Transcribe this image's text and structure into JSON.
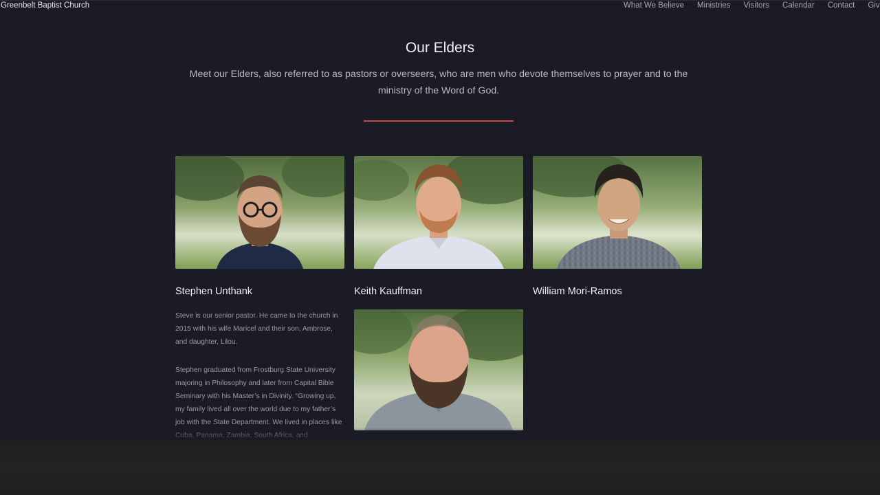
{
  "header": {
    "brand": "Greenbelt Baptist Church",
    "nav": [
      {
        "label": "What We Believe"
      },
      {
        "label": "Ministries"
      },
      {
        "label": "Visitors"
      },
      {
        "label": "Calendar"
      },
      {
        "label": "Contact"
      },
      {
        "label": "Give"
      }
    ]
  },
  "hero": {
    "title": "Our Elders",
    "subtitle": "Meet our Elders, also referred to as pastors or overseers, who are men who devote themselves to prayer and to the ministry of the Word of God.",
    "accent_color": "#d3424f"
  },
  "elders": [
    {
      "name": "Stephen Unthank",
      "photo_icon": "bearded-man-glasses-photo"
    },
    {
      "name": "Keith Kauffman",
      "photo_icon": "red-haired-man-photo"
    },
    {
      "name": "William Mori-Ramos",
      "photo_icon": "dark-haired-man-photo"
    },
    {
      "name": "",
      "photo_icon": "bearded-man-gray-shirt-photo"
    }
  ],
  "bio": {
    "paragraph_1": "Steve is our senior pastor. He came to the church in 2015 with his wife Maricel and their son, Ambrose, and daughter, Lilou.",
    "paragraph_2": "Stephen graduated from Frostburg State University majoring in Philosophy and later from Capital Bible Seminary with his Master’s in Divinity. “Growing up, my family lived all over the world due to my father’s job with the State Department. We lived in places like Cuba, Panama, Zambia, South Africa, and"
  },
  "colors": {
    "background": "#1b1b25",
    "footer": "#232326"
  }
}
